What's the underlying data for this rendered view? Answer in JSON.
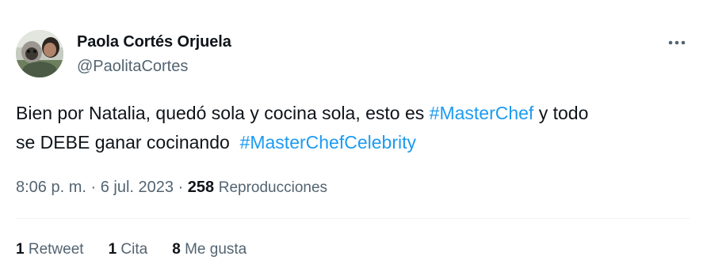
{
  "tweet": {
    "author": {
      "name": "Paola Cortés Orjuela",
      "handle": "@PaolitaCortes"
    },
    "text": {
      "part1": "Bien por Natalia, quedó sola y cocina sola, esto es ",
      "hashtag1": "#MasterChef",
      "part2": " y todo\nse DEBE ganar cocinando  ",
      "hashtag2": "#MasterChefCelebrity"
    },
    "meta": {
      "time": "8:06 p. m.",
      "sep1": " · ",
      "date": "6 jul. 2023",
      "sep2": " · ",
      "views_count": "258",
      "views_label": "Reproducciones"
    },
    "stats": {
      "retweets_count": "1",
      "retweets_label": "Retweet",
      "quotes_count": "1",
      "quotes_label": "Cita",
      "likes_count": "8",
      "likes_label": "Me gusta"
    },
    "icons": {
      "more": "more-horizontal-icon"
    },
    "colors": {
      "text": "#0f1419",
      "secondary": "#536471",
      "link": "#1d9bf0",
      "divider": "#eff3f4"
    }
  }
}
